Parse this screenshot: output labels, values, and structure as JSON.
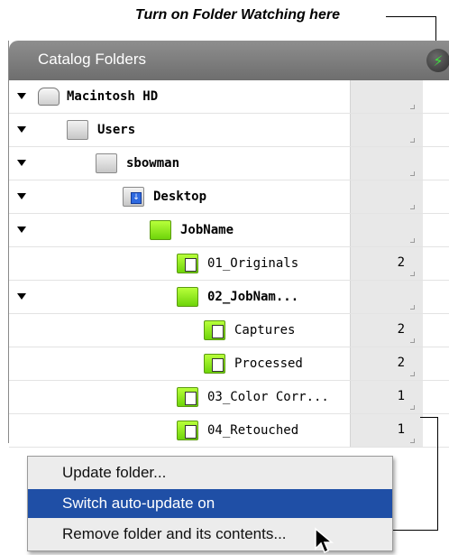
{
  "callout_top": "Turn on Folder Watching here",
  "panel": {
    "title": "Catalog Folders",
    "watch_icon": "lightning-icon",
    "watch_color": "#3de23d"
  },
  "rows": [
    {
      "label": "Macintosh HD",
      "count": "",
      "icon": "hard-drive-icon",
      "expanded": true,
      "bold": true
    },
    {
      "label": "Users",
      "count": "",
      "icon": "folder-icon",
      "expanded": true,
      "bold": true
    },
    {
      "label": "sbowman",
      "count": "",
      "icon": "folder-icon",
      "expanded": true,
      "bold": true
    },
    {
      "label": "Desktop",
      "count": "",
      "icon": "desktop-folder-icon",
      "expanded": true,
      "bold": true
    },
    {
      "label": "JobName",
      "count": "",
      "icon": "green-folder-icon",
      "expanded": true,
      "bold": true
    },
    {
      "label": "01_Originals",
      "count": "2",
      "icon": "watched-folder-icon",
      "expanded": false,
      "bold": false
    },
    {
      "label": "02_JobNam...",
      "count": "",
      "icon": "green-folder-icon",
      "expanded": true,
      "bold": true
    },
    {
      "label": "Captures",
      "count": "2",
      "icon": "watched-folder-icon",
      "expanded": false,
      "bold": false
    },
    {
      "label": "Processed",
      "count": "2",
      "icon": "watched-folder-icon",
      "expanded": false,
      "bold": false
    },
    {
      "label": "03_Color Corr...",
      "count": "1",
      "icon": "watched-folder-icon",
      "expanded": false,
      "bold": false
    },
    {
      "label": "04_Retouched",
      "count": "1",
      "icon": "watched-folder-icon",
      "expanded": false,
      "bold": false
    }
  ],
  "context_menu": {
    "items": [
      {
        "label": "Update folder...",
        "active": false
      },
      {
        "label": "Switch auto-update on",
        "active": true
      },
      {
        "label": "Remove folder and its contents...",
        "active": false
      }
    ],
    "highlight_color": "#1f4fa6"
  }
}
